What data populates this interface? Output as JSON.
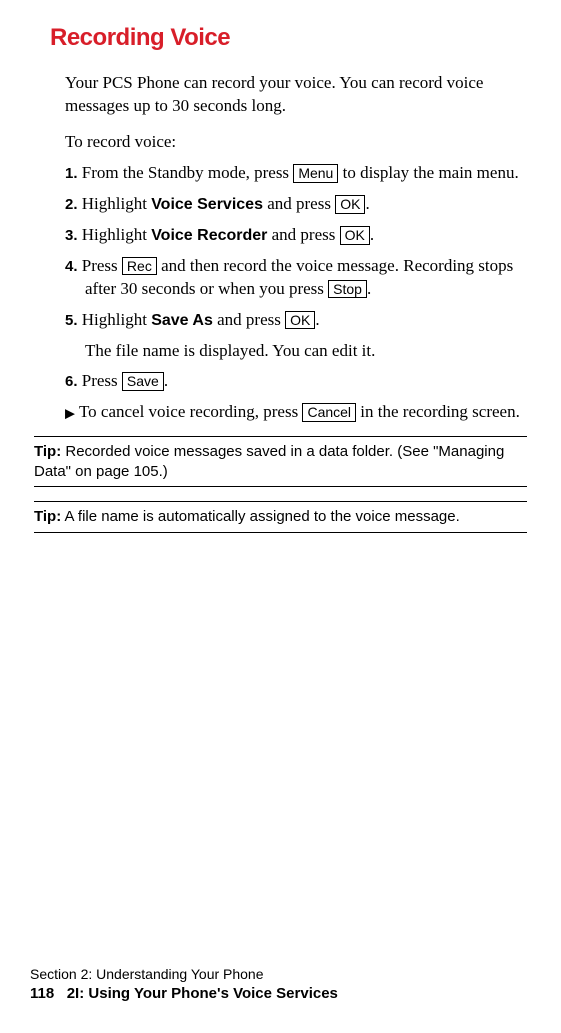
{
  "title": "Recording Voice",
  "intro": "Your PCS Phone can record your voice. You can record voice messages up to 30 seconds long.",
  "sub_intro": "To record voice:",
  "steps": {
    "s1": {
      "num": "1.",
      "t1": "From the Standby mode, press ",
      "btn": "Menu",
      "t2": " to display the main menu."
    },
    "s2": {
      "num": "2.",
      "t1": "Highlight ",
      "bold": "Voice Services",
      "t2": " and press ",
      "btn": "OK",
      "t3": "."
    },
    "s3": {
      "num": "3.",
      "t1": "Highlight ",
      "bold": "Voice Recorder",
      "t2": " and press ",
      "btn": "OK",
      "t3": "."
    },
    "s4": {
      "num": "4.",
      "t1": "Press ",
      "btn1": "Rec",
      "t2": " and then record the voice message. Recording stops after 30 seconds or when you press ",
      "btn2": "Stop",
      "t3": "."
    },
    "s5": {
      "num": "5.",
      "t1": "Highlight ",
      "bold": "Save As",
      "t2": " and press ",
      "btn": "OK",
      "t3": "."
    },
    "s5note": "The file name is displayed. You can edit it.",
    "s6": {
      "num": "6.",
      "t1": "Press ",
      "btn": "Save",
      "t2": "."
    }
  },
  "bullet": {
    "marker": "▶",
    "t1": "To cancel voice recording, press ",
    "btn": "Cancel",
    "t2": " in the recording screen."
  },
  "tip1": {
    "label": "Tip:",
    "text": " Recorded voice messages saved in a data folder. (See \"Managing Data\" on page 105.)"
  },
  "tip2": {
    "label": "Tip:",
    "text": " A file name is automatically assigned to the voice message."
  },
  "footer": {
    "line1": "Section 2: Understanding Your Phone",
    "page": "118",
    "line2": "2I: Using Your Phone's Voice Services"
  }
}
